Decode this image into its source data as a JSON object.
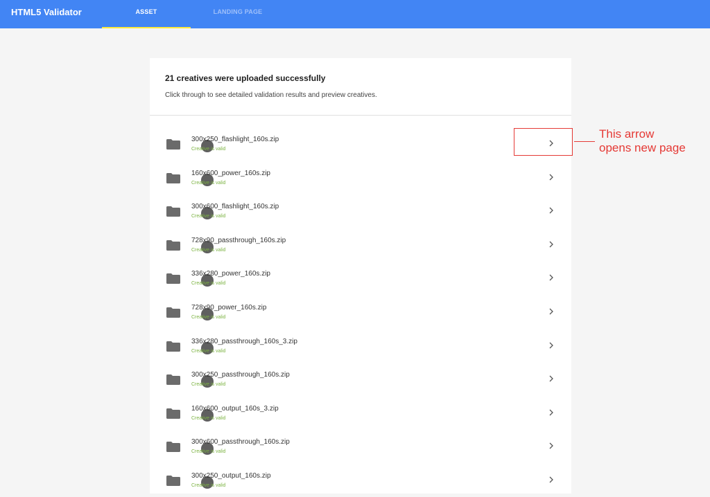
{
  "app": {
    "title": "HTML5 Validator"
  },
  "tabs": [
    {
      "label": "ASSET",
      "active": true
    },
    {
      "label": "LANDING PAGE",
      "active": false
    }
  ],
  "card": {
    "title": "21 creatives were uploaded successfully",
    "subtitle": "Click through to see detailed validation results and preview creatives."
  },
  "creatives": [
    {
      "name": "300x250_flashlight_160s.zip",
      "status": "Creative is valid"
    },
    {
      "name": "160x600_power_160s.zip",
      "status": "Creative is valid"
    },
    {
      "name": "300x600_flashlight_160s.zip",
      "status": "Creative is valid"
    },
    {
      "name": "728x90_passthrough_160s.zip",
      "status": "Creative is valid"
    },
    {
      "name": "336x280_power_160s.zip",
      "status": "Creative is valid"
    },
    {
      "name": "728x90_power_160s.zip",
      "status": "Creative is valid"
    },
    {
      "name": "336x280_passthrough_160s_3.zip",
      "status": "Creative is valid"
    },
    {
      "name": "300x250_passthrough_160s.zip",
      "status": "Creative is valid"
    },
    {
      "name": "160x600_output_160s_3.zip",
      "status": "Creative is valid"
    },
    {
      "name": "300x600_passthrough_160s.zip",
      "status": "Creative is valid"
    },
    {
      "name": "300x250_output_160s.zip",
      "status": "Creative is valid"
    }
  ],
  "annotation": {
    "line1": "This arrow",
    "line2": "opens new page"
  },
  "colors": {
    "topbar": "#4285f4",
    "active_tab_underline": "#ffeb3b",
    "valid_status": "#7cb342",
    "annotation": "#e53935"
  },
  "icons": {
    "row_icon": "folder-icon",
    "row_action": "chevron-right-icon"
  }
}
